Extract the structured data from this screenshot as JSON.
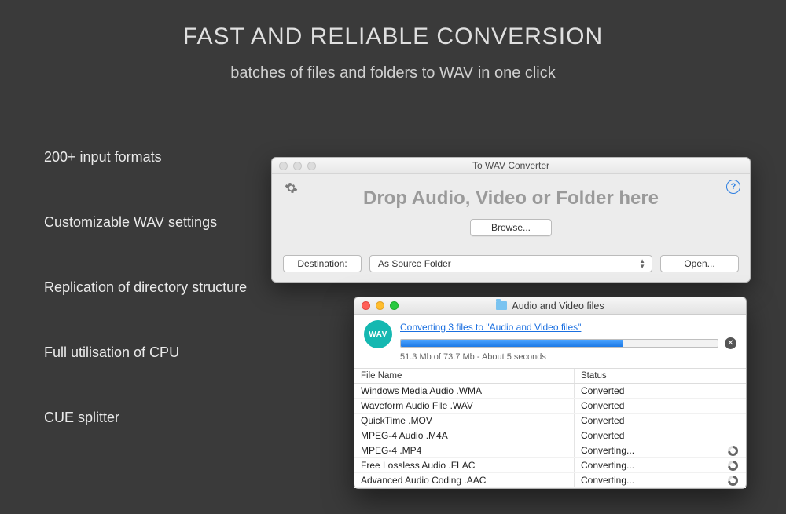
{
  "headline": "FAST AND RELIABLE CONVERSION",
  "subline": "batches of files and folders to WAV in one click",
  "features": [
    "200+ input formats",
    "Customizable WAV settings",
    "Replication of directory structure",
    "Full utilisation of CPU",
    "CUE splitter"
  ],
  "win1": {
    "title": "To WAV Converter",
    "drop": "Drop Audio, Video or Folder here",
    "browse": "Browse...",
    "dest_label": "Destination:",
    "dest_value": "As Source Folder",
    "open": "Open...",
    "help": "?"
  },
  "win2": {
    "title": "Audio and Video files",
    "link": "Converting 3 files to \"Audio and Video files\"",
    "wav_badge": "WAV",
    "stats": "51.3 Mb of 73.7 Mb - About 5 seconds",
    "progress_pct": "70%",
    "col_file": "File Name",
    "col_status": "Status",
    "rows": [
      {
        "name": "Windows Media Audio .WMA",
        "status": "Converted",
        "busy": false
      },
      {
        "name": "Waveform Audio File .WAV",
        "status": "Converted",
        "busy": false
      },
      {
        "name": "QuickTime .MOV",
        "status": "Converted",
        "busy": false
      },
      {
        "name": "MPEG-4 Audio .M4A",
        "status": "Converted",
        "busy": false
      },
      {
        "name": "MPEG-4 .MP4",
        "status": "Converting...",
        "busy": true
      },
      {
        "name": "Free Lossless Audio .FLAC",
        "status": "Converting...",
        "busy": true
      },
      {
        "name": "Advanced Audio Coding .AAC",
        "status": "Converting...",
        "busy": true
      }
    ]
  }
}
